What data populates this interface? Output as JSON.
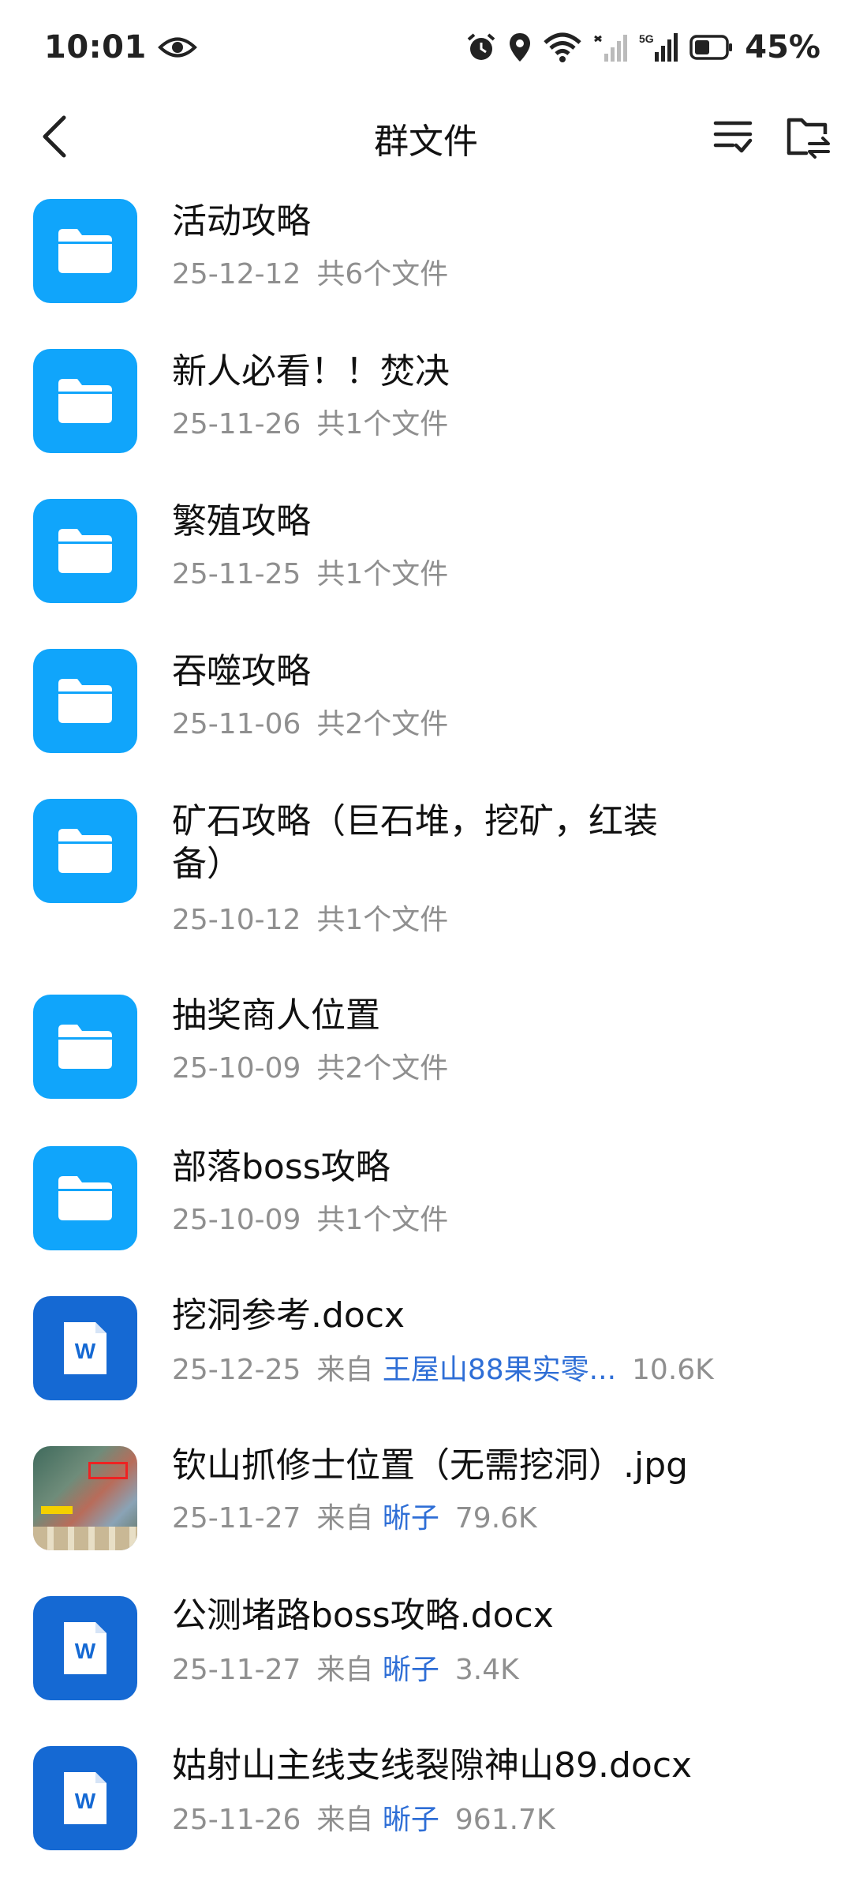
{
  "status_bar": {
    "time": "10:01",
    "battery_percent": "45%",
    "icons": [
      "eye-icon",
      "alarm-icon",
      "location-icon",
      "wifi-icon",
      "signal-icon",
      "5g-signal-icon",
      "battery-icon"
    ]
  },
  "header": {
    "title": "群文件",
    "back_icon": "chevron-left-icon",
    "sort_icon": "sort-checklist-icon",
    "transfer_icon": "folder-transfer-icon"
  },
  "colors": {
    "folder": "#10a5fb",
    "word": "#1569d3",
    "sender_link": "#2e6ed6",
    "meta_text": "#8f8f8f"
  },
  "items": [
    {
      "type": "folder",
      "name": "活动攻略",
      "date": "25-12-12",
      "info": "共6个文件"
    },
    {
      "type": "folder",
      "name": "新人必看！！焚决",
      "date": "25-11-26",
      "info": "共1个文件"
    },
    {
      "type": "folder",
      "name": "繁殖攻略",
      "date": "25-11-25",
      "info": "共1个文件"
    },
    {
      "type": "folder",
      "name": "吞噬攻略",
      "date": "25-11-06",
      "info": "共2个文件"
    },
    {
      "type": "folder",
      "name": "矿石攻略（巨石堆，挖矿，红装备）",
      "date": "25-10-12",
      "info": "共1个文件"
    },
    {
      "type": "folder",
      "name": "抽奖商人位置",
      "date": "25-10-09",
      "info": "共2个文件"
    },
    {
      "type": "folder",
      "name": "部落boss攻略",
      "date": "25-10-09",
      "info": "共1个文件"
    },
    {
      "type": "word",
      "name": "挖洞参考.docx",
      "date": "25-12-25",
      "from_label": "来自",
      "sender": "王屋山88果实零...",
      "size": "10.6K"
    },
    {
      "type": "image",
      "name": "钦山抓修士位置（无需挖洞）.jpg",
      "date": "25-11-27",
      "from_label": "来自",
      "sender": "晰子",
      "size": "79.6K"
    },
    {
      "type": "word",
      "name": "公测堵路boss攻略.docx",
      "date": "25-11-27",
      "from_label": "来自",
      "sender": "晰子",
      "size": "3.4K"
    },
    {
      "type": "word",
      "name": "姑射山主线支线裂隙神山89.docx",
      "date": "25-11-26",
      "from_label": "来自",
      "sender": "晰子",
      "size": "961.7K"
    }
  ]
}
